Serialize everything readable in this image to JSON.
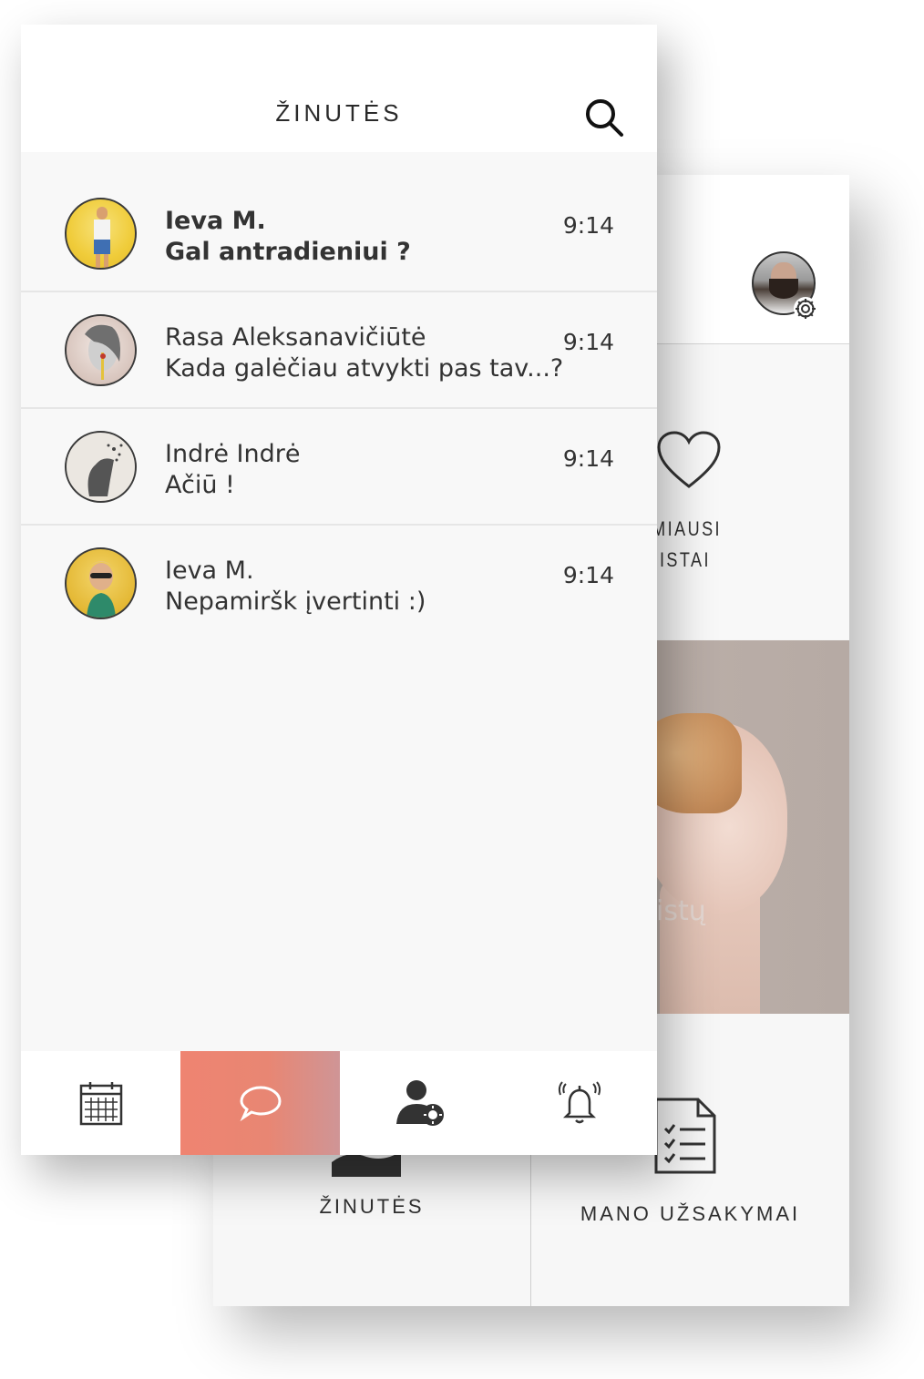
{
  "back_screen": {
    "favorites_label_line1": "STAMIAUSI",
    "favorites_label_line2": "CIALISTAI",
    "promo_text": "istų",
    "tile_messages_label": "ŽINUTĖS",
    "tile_orders_label": "MANO UŽSAKYMAI"
  },
  "front_screen": {
    "title": "ŽINUTĖS",
    "messages": [
      {
        "name": "Ieva M.",
        "text": "Gal antradieniui ?",
        "time": "9:14",
        "unread": true
      },
      {
        "name": "Rasa Aleksanavičiūtė",
        "text": "Kada galėčiau atvykti pas tav...?",
        "time": "9:14",
        "unread": false
      },
      {
        "name": "Indrė Indrė",
        "text": "Ačiū !",
        "time": "9:14",
        "unread": false
      },
      {
        "name": "Ieva M.",
        "text": "Nepamiršk įvertinti :)",
        "time": "9:14",
        "unread": false
      }
    ],
    "tabs": [
      {
        "icon": "calendar-icon",
        "active": false
      },
      {
        "icon": "chat-bubble-icon",
        "active": true
      },
      {
        "icon": "user-settings-icon",
        "active": false
      },
      {
        "icon": "alarm-bell-icon",
        "active": false
      }
    ]
  },
  "colors": {
    "active_tab_start": "#ef8471",
    "active_tab_end": "#cf9596",
    "text": "#333333",
    "background": "#f8f8f8"
  }
}
